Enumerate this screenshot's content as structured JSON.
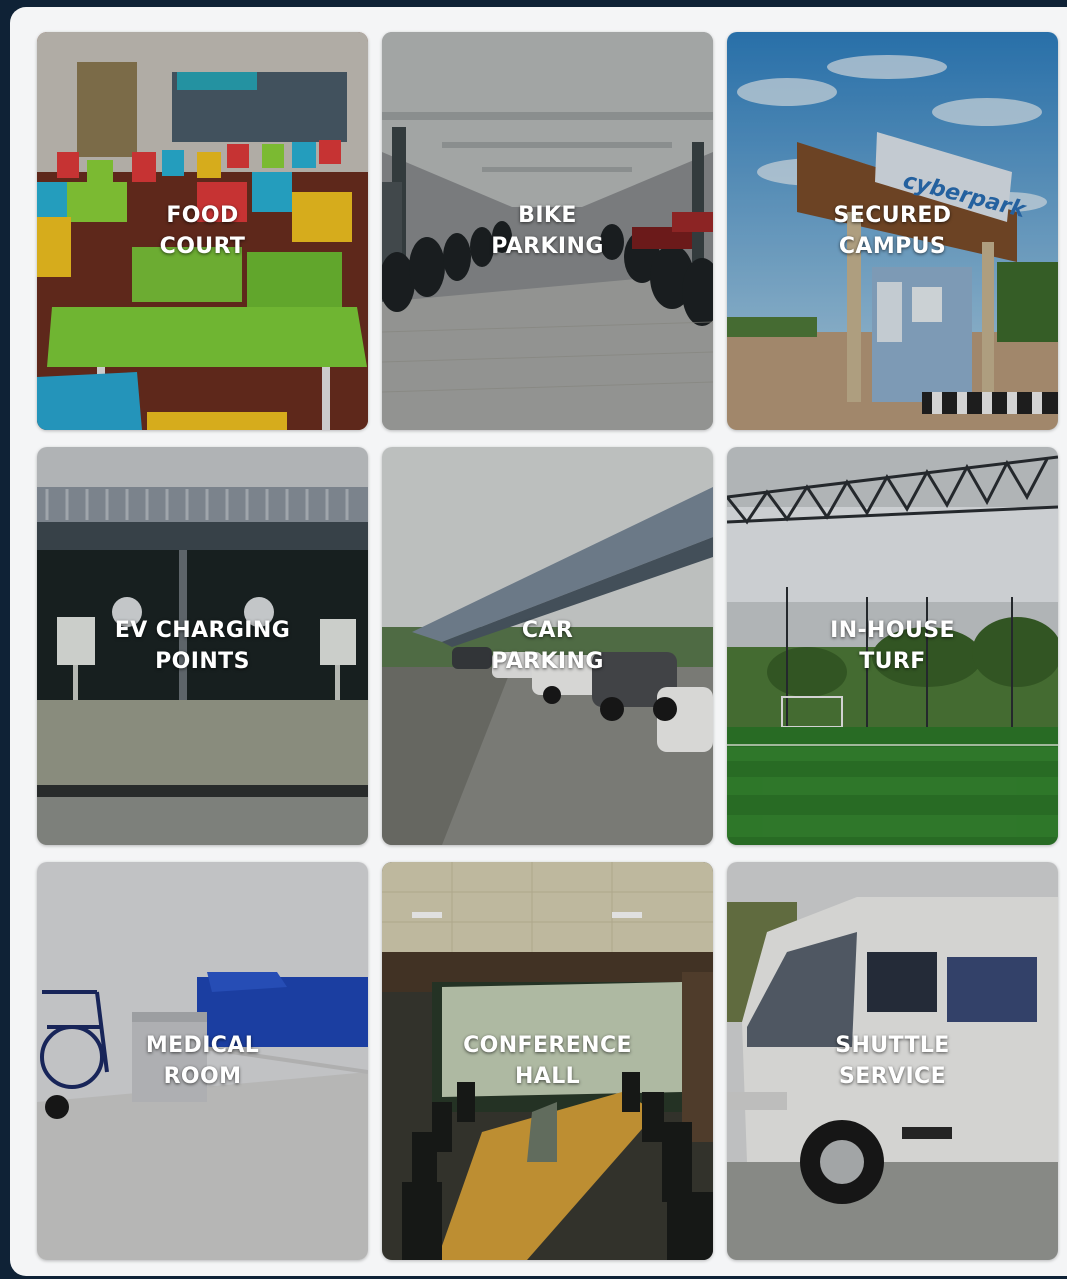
{
  "amenities": [
    {
      "line1": "FOOD",
      "line2": "COURT"
    },
    {
      "line1": "BIKE",
      "line2": "PARKING"
    },
    {
      "line1": "SECURED",
      "line2": "CAMPUS"
    },
    {
      "line1": "EV CHARGING",
      "line2": "POINTS"
    },
    {
      "line1": "CAR",
      "line2": "PARKING"
    },
    {
      "line1": "IN-HOUSE",
      "line2": "TURF"
    },
    {
      "line1": "MEDICAL",
      "line2": "ROOM"
    },
    {
      "line1": "CONFERENCE",
      "line2": "HALL"
    },
    {
      "line1": "SHUTTLE",
      "line2": "SERVICE"
    }
  ],
  "sign_text": "cyberpark",
  "colors": {
    "background": "#0f2236",
    "panel": "#f4f5f6",
    "label_text": "#ffffff"
  }
}
